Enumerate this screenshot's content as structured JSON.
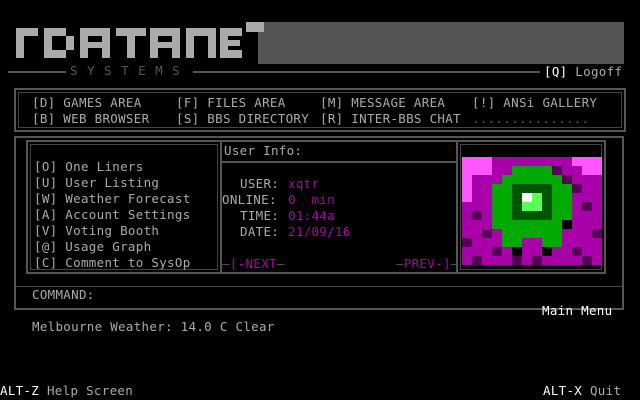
{
  "logo": {
    "name": "dataneT",
    "subtitle": "SYSTEMS"
  },
  "logoff": {
    "key": "[Q]",
    "label": " Logoff"
  },
  "menu": {
    "row1": [
      {
        "key": "[D]",
        "label": " GAMES AREA"
      },
      {
        "key": "[F]",
        "label": " FILES AREA"
      },
      {
        "key": "[M]",
        "label": " MESSAGE AREA"
      },
      {
        "key": "[!]",
        "label": " ANSi GALLERY"
      }
    ],
    "row2": [
      {
        "key": "[B]",
        "label": " WEB BROWSER"
      },
      {
        "key": "[S]",
        "label": " BBS DIRECTORY"
      },
      {
        "key": "[R]",
        "label": " INTER-BBS CHAT"
      },
      {
        "key": "",
        "label": "..............."
      }
    ]
  },
  "side_menu": [
    {
      "key": "[O]",
      "label": " One Liners"
    },
    {
      "key": "[U]",
      "label": " User Listing"
    },
    {
      "key": "[W]",
      "label": " Weather Forecast"
    },
    {
      "key": "[A]",
      "label": " Account Settings"
    },
    {
      "key": "[V]",
      "label": " Voting Booth"
    },
    {
      "key": "[@]",
      "label": " Usage Graph"
    },
    {
      "key": "[C]",
      "label": " Comment to SysOp"
    }
  ],
  "user_info": {
    "title": "User Info:",
    "user_label": "USER:",
    "user": "xqtr",
    "online_label": "ONLINE:",
    "online": "0  min",
    "time_label": "TIME:",
    "time": "01:44a",
    "date_label": "DATE:",
    "date": "21/09/16"
  },
  "nav": {
    "next": "[-NEXT",
    "prev": "PREV-]"
  },
  "command_label": "COMMAND:",
  "menu_title": "Main Menu",
  "weather": "Melbourne Weather: 14.0 C Clear",
  "footer": {
    "help_key": "ALT-Z",
    "help_label": " Help Screen",
    "quit_key": "ALT-X",
    "quit_label": " Quit"
  },
  "colors": {
    "bg": "#000000",
    "text": "#aaaaaa",
    "accent": "#aa00aa",
    "bright_accent": "#ff55ff",
    "frame": "#555555"
  }
}
